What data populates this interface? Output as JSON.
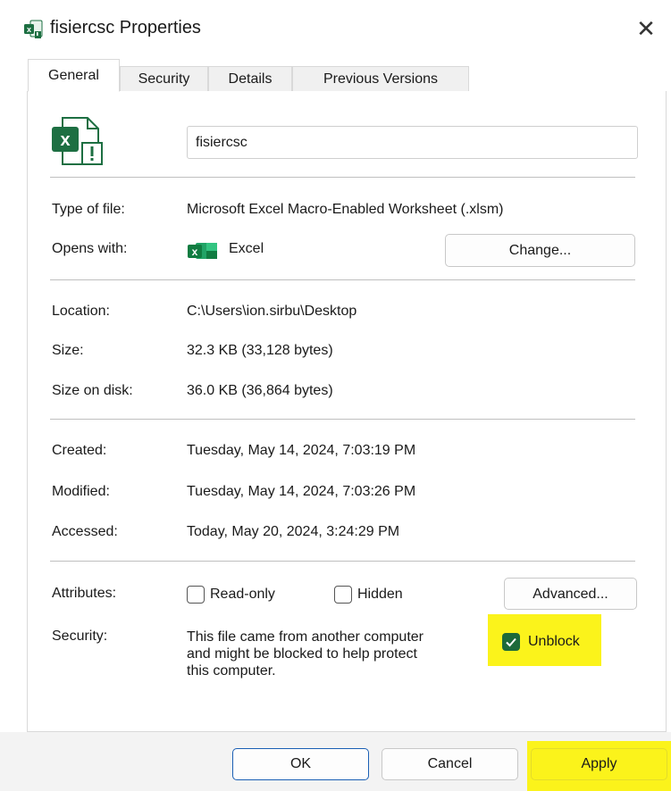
{
  "window": {
    "title": "fisiercsc Properties",
    "close_glyph": "✕"
  },
  "tabs": [
    {
      "label": "General",
      "active": true
    },
    {
      "label": "Security",
      "active": false
    },
    {
      "label": "Details",
      "active": false
    },
    {
      "label": "Previous Versions",
      "active": false
    }
  ],
  "general": {
    "file_name": "fisiercsc",
    "type_label": "Type of file:",
    "type_value": "Microsoft Excel Macro-Enabled Worksheet (.xlsm)",
    "opens_label": "Opens with:",
    "opens_value": "Excel",
    "change_button": "Change...",
    "location_label": "Location:",
    "location_value": "C:\\Users\\ion.sirbu\\Desktop",
    "size_label": "Size:",
    "size_value": "32.3 KB (33,128 bytes)",
    "size_disk_label": "Size on disk:",
    "size_disk_value": "36.0 KB (36,864 bytes)",
    "created_label": "Created:",
    "created_value": "Tuesday, May 14, 2024, 7:03:19 PM",
    "modified_label": "Modified:",
    "modified_value": "Tuesday, May 14, 2024, 7:03:26 PM",
    "accessed_label": "Accessed:",
    "accessed_value": "Today, May 20, 2024, 3:24:29 PM",
    "attributes_label": "Attributes:",
    "readonly_label": "Read-only",
    "readonly_checked": false,
    "hidden_label": "Hidden",
    "hidden_checked": false,
    "advanced_button": "Advanced...",
    "security_label": "Security:",
    "security_line1": "This file came from another computer",
    "security_line2": "and might be blocked to help protect",
    "security_line3": "this computer.",
    "unblock_label": "Unblock",
    "unblock_checked": true
  },
  "footer": {
    "ok": "OK",
    "cancel": "Cancel",
    "apply": "Apply"
  },
  "colors": {
    "excel_green": "#1d6f42",
    "highlight": "#fbf31b",
    "checkbox_checked": "#1d6a3a",
    "ok_border": "#1a5fb4"
  },
  "icons": {
    "title": "excel-file-icon",
    "file": "excel-file-blocked-icon",
    "app": "excel-app-icon",
    "check": "checkmark-icon"
  }
}
